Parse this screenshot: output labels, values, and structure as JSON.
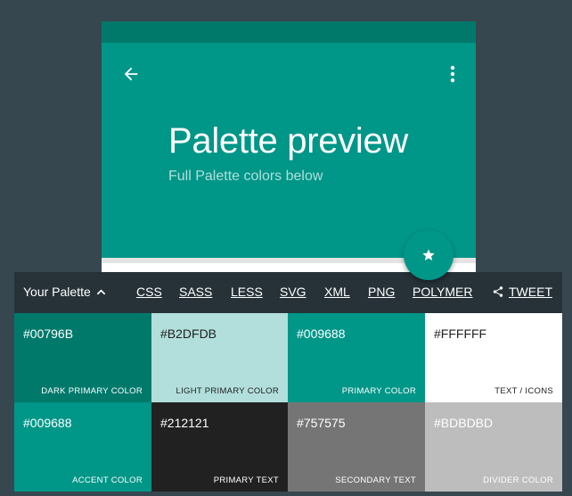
{
  "preview": {
    "title": "Palette preview",
    "subtitle": "Full Palette colors below",
    "back_icon": "arrow-left-icon",
    "menu_icon": "more-vertical-icon",
    "fab_icon": "star-icon",
    "colors": {
      "statusbar": "#00796B",
      "toolbar": "#009688",
      "fab": "#009688"
    }
  },
  "toolbar": {
    "palette_label": "Your Palette",
    "palette_icon": "chevron-up-icon",
    "links": [
      "CSS",
      "SASS",
      "LESS",
      "SVG",
      "XML",
      "PNG",
      "POLYMER"
    ],
    "tweet_label": "TWEET",
    "tweet_icon": "share-icon"
  },
  "swatches": [
    {
      "hex": "#00796B",
      "label": "DARK PRIMARY COLOR",
      "color": "#00796B",
      "text_color": "#FFFFFF"
    },
    {
      "hex": "#B2DFDB",
      "label": "LIGHT PRIMARY COLOR",
      "color": "#B2DFDB",
      "text_color": "#212121"
    },
    {
      "hex": "#009688",
      "label": "PRIMARY COLOR",
      "color": "#009688",
      "text_color": "#FFFFFF"
    },
    {
      "hex": "#FFFFFF",
      "label": "TEXT / ICONS",
      "color": "#FFFFFF",
      "text_color": "#212121"
    },
    {
      "hex": "#009688",
      "label": "ACCENT COLOR",
      "color": "#009688",
      "text_color": "#FFFFFF"
    },
    {
      "hex": "#212121",
      "label": "PRIMARY TEXT",
      "color": "#212121",
      "text_color": "#FFFFFF"
    },
    {
      "hex": "#757575",
      "label": "SECONDARY TEXT",
      "color": "#757575",
      "text_color": "#FFFFFF"
    },
    {
      "hex": "#BDBDBD",
      "label": "DIVIDER COLOR",
      "color": "#BDBDBD",
      "text_color": "#FFFFFF"
    }
  ]
}
